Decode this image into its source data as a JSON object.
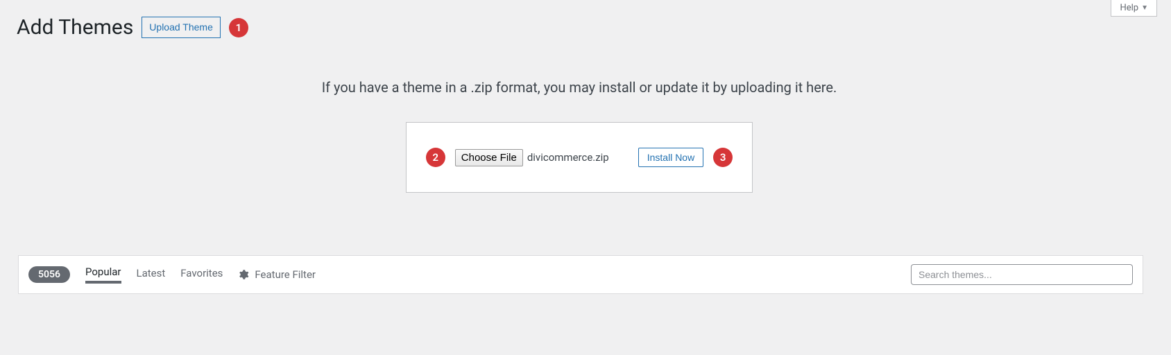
{
  "header": {
    "title": "Add Themes",
    "upload_button": "Upload Theme",
    "help_tab": "Help"
  },
  "upload": {
    "instructions": "If you have a theme in a .zip format, you may install or update it by uploading it here.",
    "choose_file_label": "Choose File",
    "selected_file": "divicommerce.zip",
    "install_button": "Install Now"
  },
  "annotations": {
    "step1": "1",
    "step2": "2",
    "step3": "3"
  },
  "filter_bar": {
    "count": "5056",
    "tabs": {
      "popular": "Popular",
      "latest": "Latest",
      "favorites": "Favorites",
      "feature_filter": "Feature Filter"
    },
    "search_placeholder": "Search themes..."
  }
}
